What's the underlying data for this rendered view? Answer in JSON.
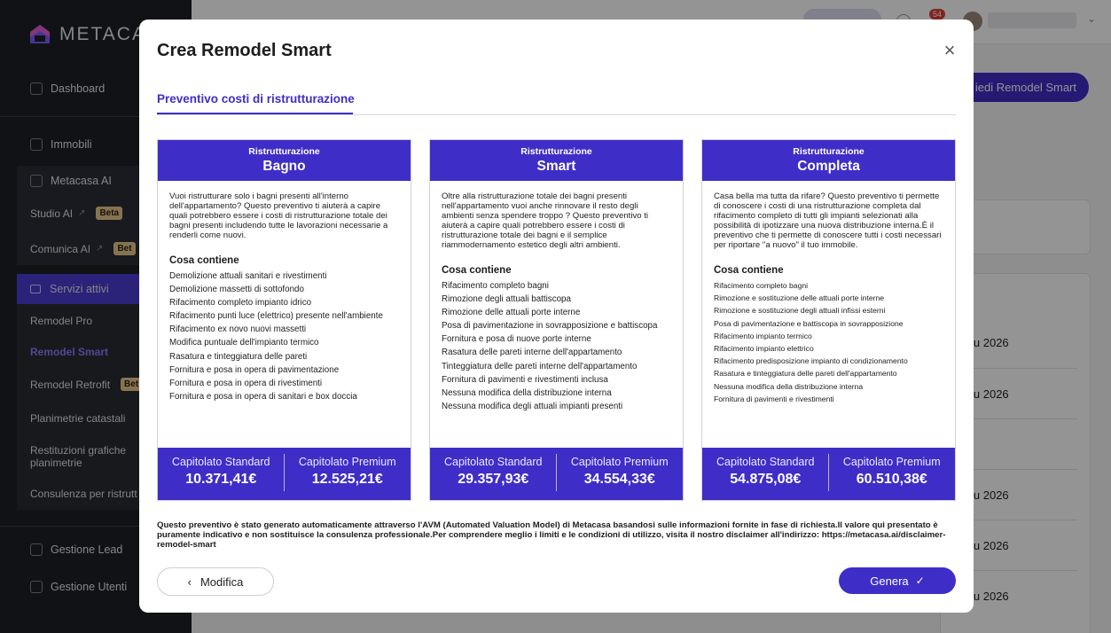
{
  "app": {
    "logo_text": "METACAS"
  },
  "sidebar": {
    "dashboard": "Dashboard",
    "immobili": "Immobili",
    "metacasa_ai": "Metacasa AI",
    "studio_ai": "Studio AI",
    "comunica_ai": "Comunica AI",
    "beta": "Beta",
    "beta_short": "Bet",
    "servizi_attivi": "Servizi attivi",
    "remodel_pro": "Remodel Pro",
    "remodel_smart": "Remodel Smart",
    "remodel_retrofit": "Remodel Retrofit",
    "planimetrie": "Planimetrie catastali",
    "restituzioni_line1": "Restituzioni grafiche",
    "restituzioni_line2": "planimetrie",
    "consulenza": "Consulenza per ristrutt",
    "gestione_lead": "Gestione Lead",
    "gestione_utenti": "Gestione Utenti"
  },
  "topbar": {
    "notifications_count": "54"
  },
  "background": {
    "main_button": "iedi Remodel Smart",
    "row_dates": [
      "iu 2026",
      "iu 2026",
      "iu 2026",
      "iu 2026",
      "iu 2026"
    ]
  },
  "modal": {
    "title": "Crea Remodel Smart",
    "close_symbol": "×",
    "tab": "Preventivo costi di ristrutturazione",
    "contents_heading": "Cosa contiene",
    "cards": [
      {
        "sup": "Ristrutturazione",
        "name": "Bagno",
        "description": "Vuoi ristrutturare solo i bagni presenti all'interno dell'appartamento? Questo preventivo ti aiuterà a capire quali potrebbero essere i costi di ristrutturazione totale dei bagni presenti includendo tutte le lavorazioni necessarie a renderli come nuovi.",
        "items": [
          "Demolizione attuali sanitari e rivestimenti",
          "Demolizione massetti di sottofondo",
          "Rifacimento completo impianto idrico",
          "Rifacimento punti luce (elettrico) presente nell'ambiente",
          "Rifacimento ex novo nuovi massetti",
          "Modifica puntuale dell'impianto termico",
          "Rasatura e tinteggiatura delle pareti",
          "Fornitura e posa in opera di pavimentazione",
          "Fornitura e posa in opera di rivestimenti",
          "Fornitura e posa in opera di sanitari e box doccia"
        ],
        "standard_label": "Capitolato Standard",
        "standard_price": "10.371,41€",
        "premium_label": "Capitolato Premium",
        "premium_price": "12.525,21€"
      },
      {
        "sup": "Ristrutturazione",
        "name": "Smart",
        "description": "Oltre alla ristrutturazione totale dei bagni presenti nell'appartamento vuoi anche rinnovare il resto degli ambienti senza spendere troppo ? Questo preventivo ti aiuterà a capire quali potrebbero essere i costi di ristrutturazione totale dei bagni e il semplice riammodernamento estetico degli altri ambienti.",
        "items": [
          "Rifacimento completo bagni",
          "Rimozione degli attuali battiscopa",
          "Rimozione delle attuali porte interne",
          "Posa di pavimentazione in sovrapposizione e battiscopa",
          "Fornitura e posa di nuove porte interne",
          "Rasatura delle pareti interne dell'appartamento",
          "Tinteggiatura delle pareti interne dell'appartamento",
          "Fornitura di pavimenti e rivestimenti inclusa",
          "Nessuna modifica della distribuzione interna",
          "Nessuna modifica degli attuali impianti presenti"
        ],
        "standard_label": "Capitolato Standard",
        "standard_price": "29.357,93€",
        "premium_label": "Capitolato Premium",
        "premium_price": "34.554,33€"
      },
      {
        "sup": "Ristrutturazione",
        "name": "Completa",
        "description": "Casa bella ma tutta da rifare? Questo preventivo ti permette di conoscere i costi di una ristrutturazione completa dal rifacimento completo di tutti gli impianti selezionati alla possibilità di ipotizzare una nuova distribuzione interna.È il preventivo che ti permette di conoscere tutti i costi necessari per riportare \"a nuovo\" il tuo immobile.",
        "items": [
          "Rifacimento completo bagni",
          "Rimozione e sostituzione delle attuali porte interne",
          "Rimozione e sostituzione degli attuali infissi esterni",
          "Posa di pavimentazione e battiscopa in sovrapposizione",
          "Rifacimento impianto termico",
          "Rifacimento impianto elettrico",
          "Rifacimento predisposizione impianto di condizionamento",
          "Rasatura e tinteggiatura delle pareti dell'appartamento",
          "Nessuna modifica della distribuzione interna",
          "Fornitura di pavimenti e rivestimenti"
        ],
        "standard_label": "Capitolato Standard",
        "standard_price": "54.875,08€",
        "premium_label": "Capitolato Premium",
        "premium_price": "60.510,38€"
      }
    ],
    "disclaimer": "Questo preventivo è stato generato automaticamente attraverso l'AVM (Automated Valuation Model) di Metacasa basandosi sulle informazioni fornite in fase di richiesta.Il valore qui presentato è puramente indicativo e non sostituisce la consulenza professionale.Per comprendere meglio i limiti e le condizioni di utilizzo, visita il nostro disclaimer all'indirizzo: https://metacasa.ai/disclaimer-remodel-smart",
    "modify_button": "Modifica",
    "generate_button": "Genera"
  },
  "colors": {
    "accent": "#3f2dc8",
    "sidebar": "#1e1f26",
    "beta": "#e7c88a"
  }
}
